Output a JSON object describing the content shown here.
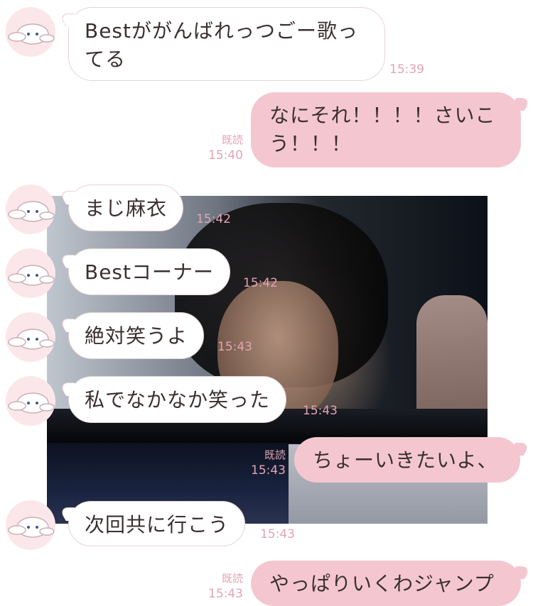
{
  "messages": [
    {
      "side": "in",
      "text": "Bestががんばれっつごー歌ってる",
      "time": "15:39"
    },
    {
      "side": "out",
      "text": "なにそれ！！！！さいこう！！！",
      "time": "15:40",
      "read": "既読"
    },
    {
      "side": "in",
      "text": "まじ麻衣",
      "time": "15:42"
    },
    {
      "side": "in",
      "text": "Bestコーナー",
      "time": "15:42"
    },
    {
      "side": "in",
      "text": "絶対笑うよ",
      "time": "15:43"
    },
    {
      "side": "in",
      "text": "私でなかなか笑った",
      "time": "15:43"
    },
    {
      "side": "out",
      "text": "ちょーいきたいよ、",
      "time": "15:43",
      "read": "既読"
    },
    {
      "side": "in",
      "text": "次回共に行こう",
      "time": "15:43"
    },
    {
      "side": "out",
      "text": "やっぱりいくわジャンプ",
      "time": "15:43",
      "read": "既読"
    }
  ],
  "colors": {
    "outgoing_bubble": "#f4c7d0",
    "incoming_bubble": "#ffffff",
    "timestamp": "#e2a4b4"
  },
  "avatar_icon": "cinnamoroll-avatar-icon"
}
